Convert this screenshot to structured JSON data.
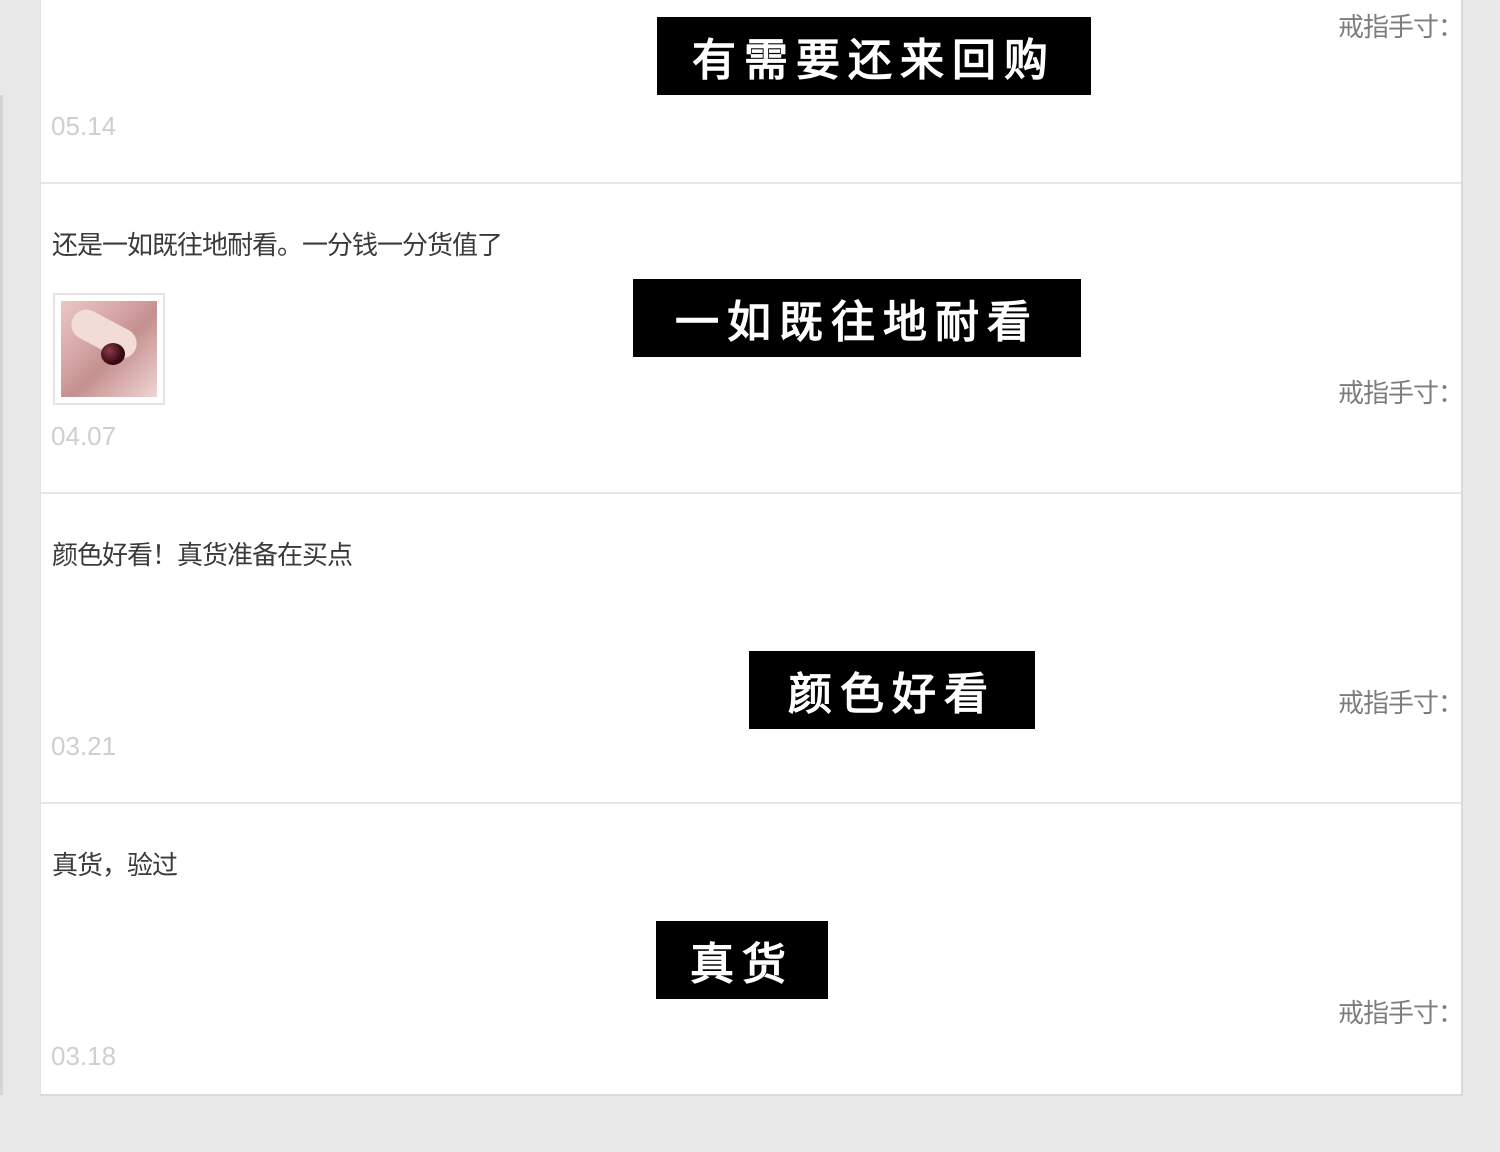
{
  "reviews": [
    {
      "text": "",
      "banner": "有需要还来回购",
      "has_image": false,
      "date": "05.14",
      "spec_label": "戒指手寸："
    },
    {
      "text": "还是一如既往地耐看。一分钱一分货值了",
      "banner": "一如既往地耐看",
      "has_image": true,
      "date": "04.07",
      "spec_label": "戒指手寸："
    },
    {
      "text": "颜色好看！真货准备在买点",
      "banner": "颜色好看",
      "has_image": false,
      "date": "03.21",
      "spec_label": "戒指手寸："
    },
    {
      "text": "真货，验过",
      "banner": "真货",
      "has_image": false,
      "date": "03.18",
      "spec_label": "戒指手寸："
    }
  ],
  "colors": {
    "page_bg": "#e8e8e8",
    "panel_bg": "#ffffff",
    "banner_bg": "#000000",
    "banner_text": "#ffffff",
    "date_text": "#cfcfcf",
    "spec_text": "#7d7d7d"
  }
}
